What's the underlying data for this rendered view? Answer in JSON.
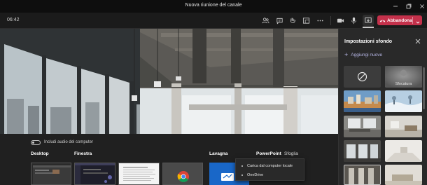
{
  "window": {
    "title": "Nuova riunione del canale",
    "minimize_icon": "minimize-icon",
    "maximize_icon": "restore-icon",
    "close_icon": "close-icon"
  },
  "toolbar": {
    "timer": "06:42",
    "icons": [
      "people-icon",
      "chat-icon",
      "reactions-icon",
      "rooms-icon",
      "more-icon",
      "camera-icon",
      "microphone-icon",
      "share-tray-icon"
    ],
    "leave_label": "Abbandona",
    "leave_color": "#c4314b"
  },
  "share_tray": {
    "audio_toggle_label": "Includi audio del computer",
    "audio_toggle_on": false,
    "sections": {
      "desktop": "Desktop",
      "window": "Finestra",
      "whiteboard": "Lavagna",
      "powerpoint": "PowerPoint",
      "browse": "Sfoglia"
    }
  },
  "browse_menu": {
    "items": [
      "Carica dal computer locale",
      "OneDrive"
    ]
  },
  "background_panel": {
    "title": "Impostazioni sfondo",
    "add_new": "Aggiungi nuove",
    "blur_label": "Sfocatura",
    "accent": "#b8b8e8"
  }
}
